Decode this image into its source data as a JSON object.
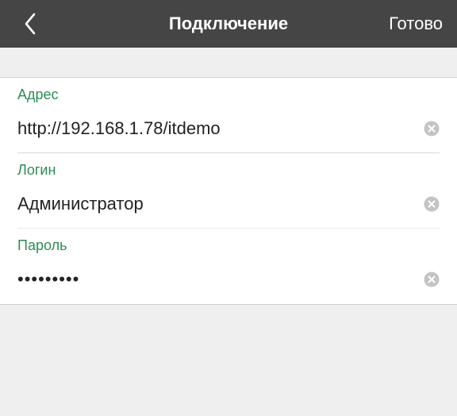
{
  "header": {
    "title": "Подключение",
    "done_label": "Готово",
    "back_icon": "chevron-left-icon"
  },
  "form": {
    "address": {
      "label": "Адрес",
      "value": "http://192.168.1.78/itdemo"
    },
    "login": {
      "label": "Логин",
      "value": "Администратор"
    },
    "password": {
      "label": "Пароль",
      "value": "•••••••••"
    }
  },
  "colors": {
    "topbar": "#454545",
    "label_accent": "#2e8b57",
    "page_bg": "#efefef",
    "clear_icon": "#c4c4c4"
  }
}
